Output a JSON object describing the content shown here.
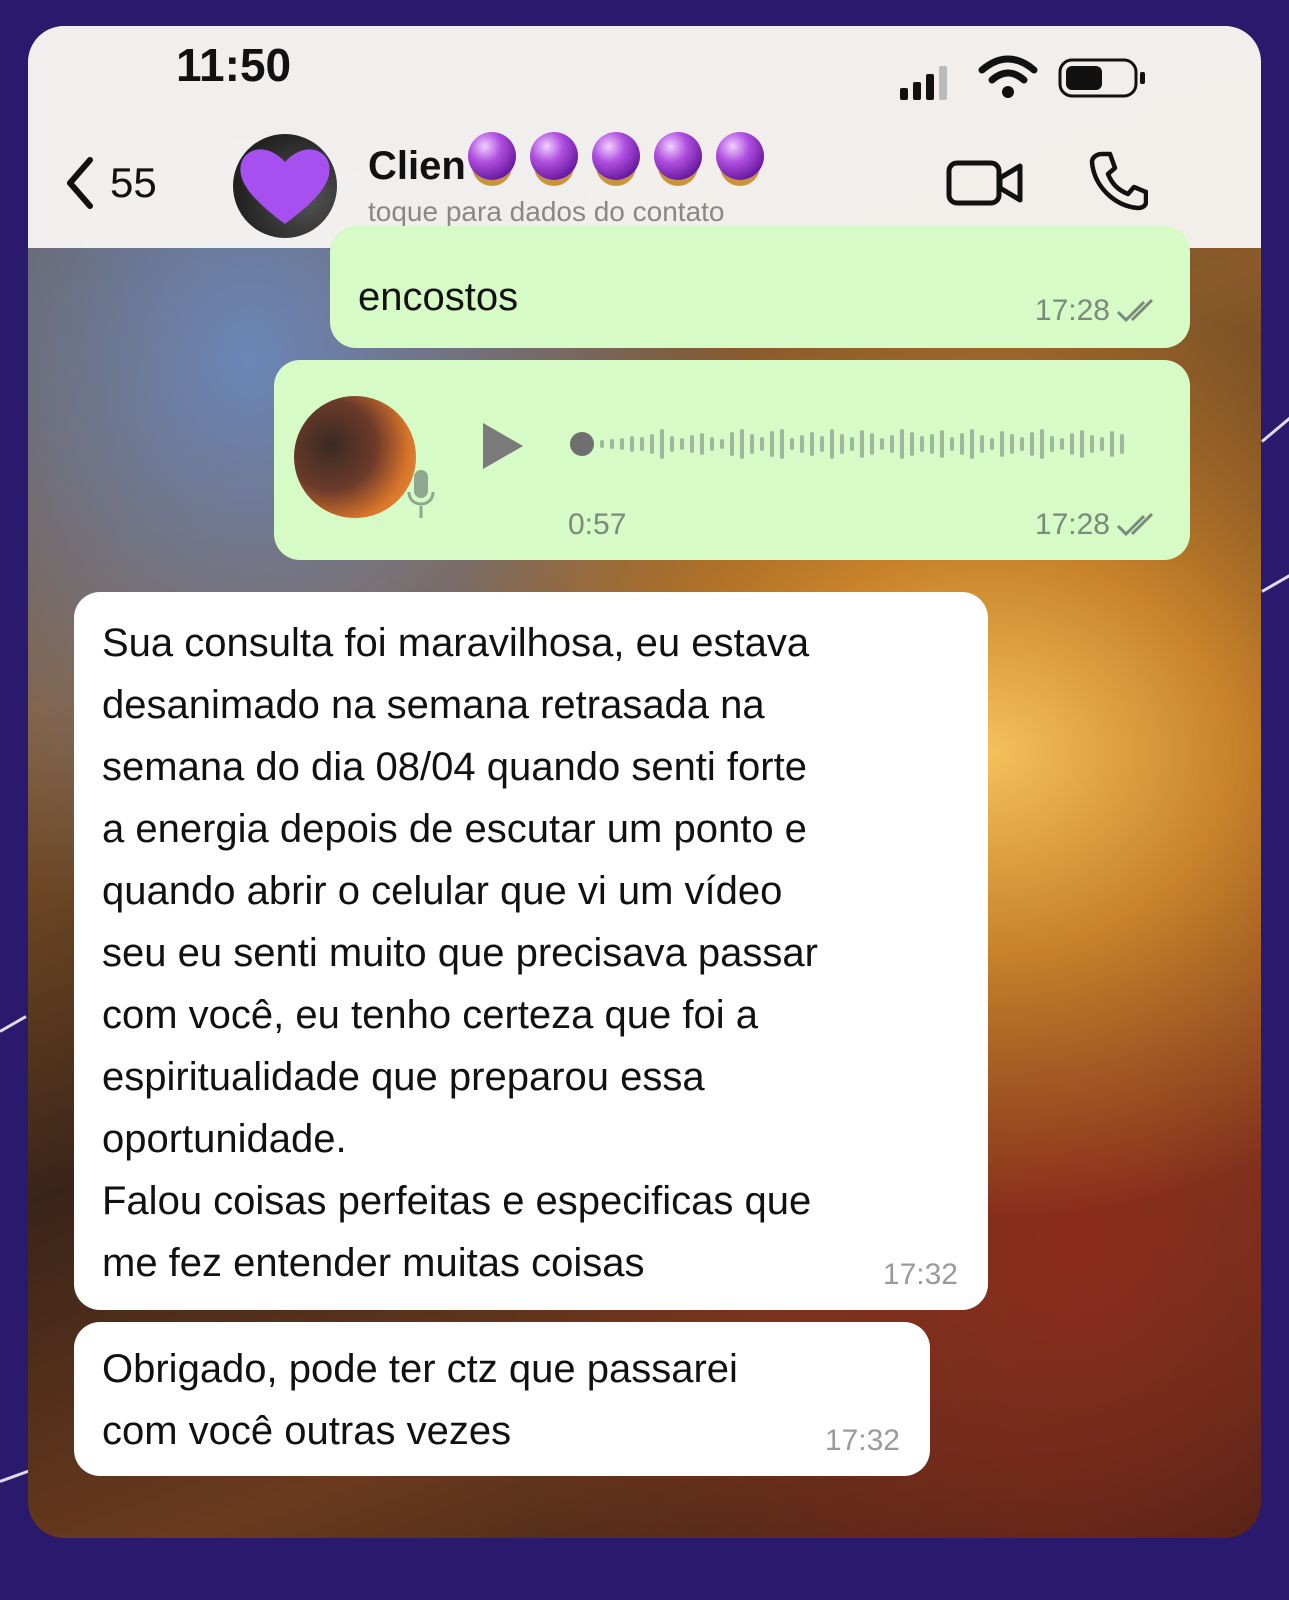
{
  "status_bar": {
    "time": "11:50"
  },
  "header": {
    "back_count": "55",
    "contact_name": "Clien",
    "contact_subtitle": "toque para dados do contato"
  },
  "messages": [
    {
      "type": "text",
      "direction": "outgoing",
      "text": "encostos",
      "time": "17:28",
      "read": true
    },
    {
      "type": "voice",
      "direction": "outgoing",
      "duration": "0:57",
      "time": "17:28",
      "read": true
    },
    {
      "type": "text",
      "direction": "incoming",
      "text": "Sua consulta foi maravilhosa, eu estava\ndesanimado na semana retrasada na\nsemana do dia 08/04 quando senti forte\na energia depois de escutar um ponto e\nquando abrir o celular que vi um vídeo\nseu eu senti muito que precisava passar\ncom você, eu tenho certeza que foi a\nespiritualidade que preparou essa\noportunidade.\nFalou coisas perfeitas e especificas que\nme fez entender muitas coisas",
      "time": "17:32"
    },
    {
      "type": "text",
      "direction": "incoming",
      "text": "Obrigado, pode ter ctz que passarei\ncom você outras vezes",
      "time": "17:32"
    }
  ],
  "colors": {
    "outgoing_bubble": "#d7fbc6",
    "incoming_bubble": "#ffffff",
    "frame": "#2a1a6e"
  },
  "icons": [
    "back-chevron-icon",
    "heart-icon",
    "crystal-ball-icon",
    "video-call-icon",
    "phone-icon",
    "play-icon",
    "microphone-icon",
    "double-check-icon"
  ]
}
